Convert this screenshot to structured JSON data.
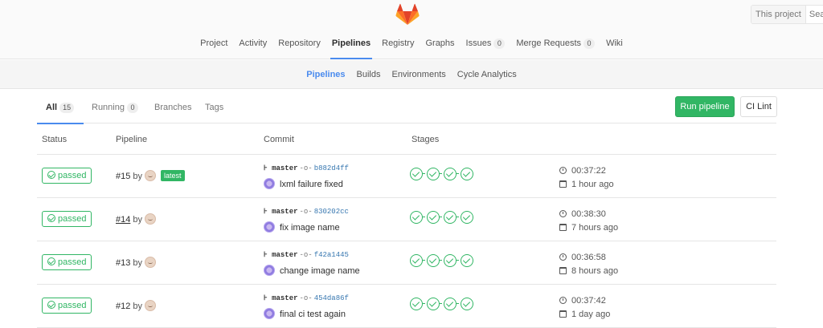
{
  "header": {
    "search_scope": "This project",
    "search_placeholder": "Search",
    "nav": [
      {
        "label": "Project"
      },
      {
        "label": "Activity"
      },
      {
        "label": "Repository"
      },
      {
        "label": "Pipelines",
        "active": true
      },
      {
        "label": "Registry"
      },
      {
        "label": "Graphs"
      },
      {
        "label": "Issues",
        "count": "0"
      },
      {
        "label": "Merge Requests",
        "count": "0"
      },
      {
        "label": "Wiki"
      }
    ]
  },
  "subnav": {
    "items": [
      {
        "label": "Pipelines",
        "active": true
      },
      {
        "label": "Builds"
      },
      {
        "label": "Environments"
      },
      {
        "label": "Cycle Analytics"
      }
    ]
  },
  "tabs": {
    "all_label": "All",
    "all_count": "15",
    "running_label": "Running",
    "running_count": "0",
    "branches_label": "Branches",
    "tags_label": "Tags"
  },
  "actions": {
    "run_pipeline": "Run pipeline",
    "ci_lint": "CI Lint"
  },
  "table": {
    "headers": {
      "status": "Status",
      "pipeline": "Pipeline",
      "commit": "Commit",
      "stages": "Stages"
    },
    "rows": [
      {
        "status": "passed",
        "pipeline_id": "#15",
        "by": "by",
        "latest": "latest",
        "branch": "master",
        "sha": "b882d4ff",
        "message": "lxml failure fixed",
        "duration": "00:37:22",
        "ago": "1 hour ago"
      },
      {
        "status": "passed",
        "pipeline_id": "#14",
        "by": "by",
        "branch": "master",
        "sha": "830202cc",
        "message": "fix image name",
        "duration": "00:38:30",
        "ago": "7 hours ago"
      },
      {
        "status": "passed",
        "pipeline_id": "#13",
        "by": "by",
        "branch": "master",
        "sha": "f42a1445",
        "message": "change image name",
        "duration": "00:36:58",
        "ago": "8 hours ago"
      },
      {
        "status": "passed",
        "pipeline_id": "#12",
        "by": "by",
        "branch": "master",
        "sha": "454da86f",
        "message": "final ci test again",
        "duration": "00:37:42",
        "ago": "1 day ago"
      }
    ]
  },
  "colors": {
    "success": "#31b664",
    "accent": "#4a8bee",
    "link": "#3777b0"
  },
  "icons": [
    "gitlab-logo-icon",
    "check-circle-icon",
    "branch-icon",
    "commit-icon",
    "timer-icon",
    "calendar-icon"
  ]
}
